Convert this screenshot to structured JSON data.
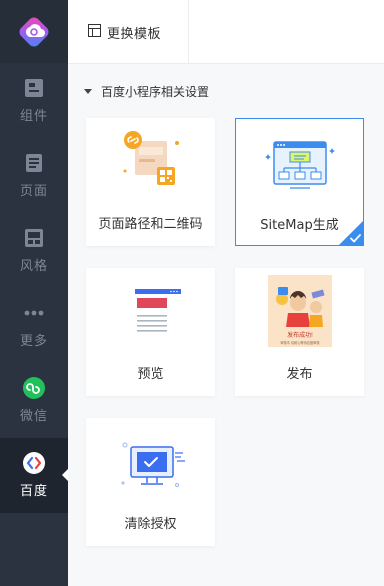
{
  "sidebar": {
    "logo": "app-logo",
    "items": [
      {
        "label": "组件",
        "icon": "component-icon"
      },
      {
        "label": "页面",
        "icon": "page-icon"
      },
      {
        "label": "风格",
        "icon": "style-icon"
      },
      {
        "label": "更多",
        "icon": "more-icon"
      },
      {
        "label": "微信",
        "icon": "wechat-icon"
      },
      {
        "label": "百度",
        "icon": "baidu-icon"
      }
    ],
    "active_index": 5
  },
  "topbar": {
    "template_button_label": "更换模板",
    "template_button_icon": "template-icon"
  },
  "section": {
    "title": "百度小程序相关设置"
  },
  "cards": [
    {
      "label": "页面路径和二维码",
      "selected": false
    },
    {
      "label": "SiteMap生成",
      "selected": true
    },
    {
      "label": "预览",
      "selected": false
    },
    {
      "label": "发布",
      "selected": false
    },
    {
      "label": "清除授权",
      "selected": false
    }
  ],
  "publish_art": {
    "title": "发布成功!",
    "subtitle": "审核中 请耐心等待百度审核"
  },
  "colors": {
    "sidebar_bg": "#2b3340",
    "accent": "#3a8dee",
    "wechat_green": "#20c15a"
  }
}
